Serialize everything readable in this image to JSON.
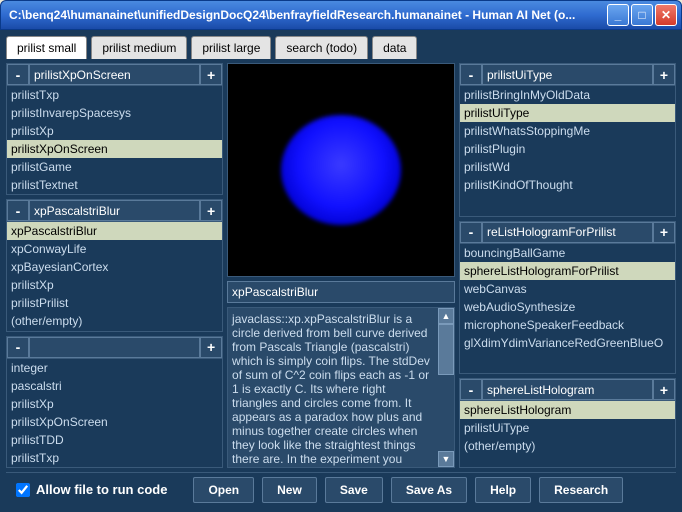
{
  "window": {
    "title": "C:\\benq24\\humanainet\\unifiedDesignDocQ24\\benfrayfieldResearch.humanainet - Human AI Net (o..."
  },
  "tabs": [
    {
      "label": "prilist small"
    },
    {
      "label": "prilist medium"
    },
    {
      "label": "prilist large"
    },
    {
      "label": "search (todo)"
    },
    {
      "label": "data"
    }
  ],
  "minus": "-",
  "plus": "+",
  "left": {
    "p1": {
      "value": "prilistXpOnScreen",
      "items": [
        "prilistTxp",
        "prilistInvarepSpacesys",
        "prilistXp",
        "prilistXpOnScreen",
        "prilistGame",
        "prilistTextnet"
      ],
      "sel": 3
    },
    "p2": {
      "value": "xpPascalstriBlur",
      "items": [
        "xpPascalstriBlur",
        "xpConwayLife",
        "xpBayesianCortex",
        "prilistXp",
        "prilistPrilist",
        "(other/empty)"
      ],
      "sel": 0
    },
    "p3": {
      "value": "",
      "items": [
        "integer",
        "pascalstri",
        "prilistXp",
        "prilistXpOnScreen",
        "prilistTDD",
        "prilistTxp"
      ],
      "sel": -1
    }
  },
  "mid": {
    "title": "xpPascalstriBlur",
    "desc": "javaclass::xp.xpPascalstriBlur is a circle derived from bell curve derived from Pascals Triangle (pascalstri) which is simply coin flips. The stdDev of sum of C^2 coin flips each as -1 or 1 is exactly C. Its where right triangles and circles come from. It appears as a paradox how plus and minus together create circles when they look like the straightest things there are. In the experiment you"
  },
  "right": {
    "p1": {
      "value": "prilistUiType",
      "items": [
        "prilistBringInMyOldData",
        "prilistUiType",
        "prilistWhatsStoppingMe",
        "prilistPlugin",
        "prilistWd",
        "prilistKindOfThought"
      ],
      "sel": 1
    },
    "p2": {
      "value": "reListHologramForPrilist",
      "items": [
        "bouncingBallGame",
        "sphereListHologramForPrilist",
        "webCanvas",
        "webAudioSynthesize",
        "microphoneSpeakerFeedback",
        "glXdimYdimVarianceRedGreenBlueO"
      ],
      "sel": 1
    },
    "p3": {
      "value": "sphereListHologram",
      "items": [
        "sphereListHologram",
        "prilistUiType",
        "(other/empty)"
      ],
      "sel": 0
    }
  },
  "footer": {
    "check": "Allow file to run code",
    "buttons": [
      "Open",
      "New",
      "Save",
      "Save As",
      "Help",
      "Research"
    ]
  }
}
